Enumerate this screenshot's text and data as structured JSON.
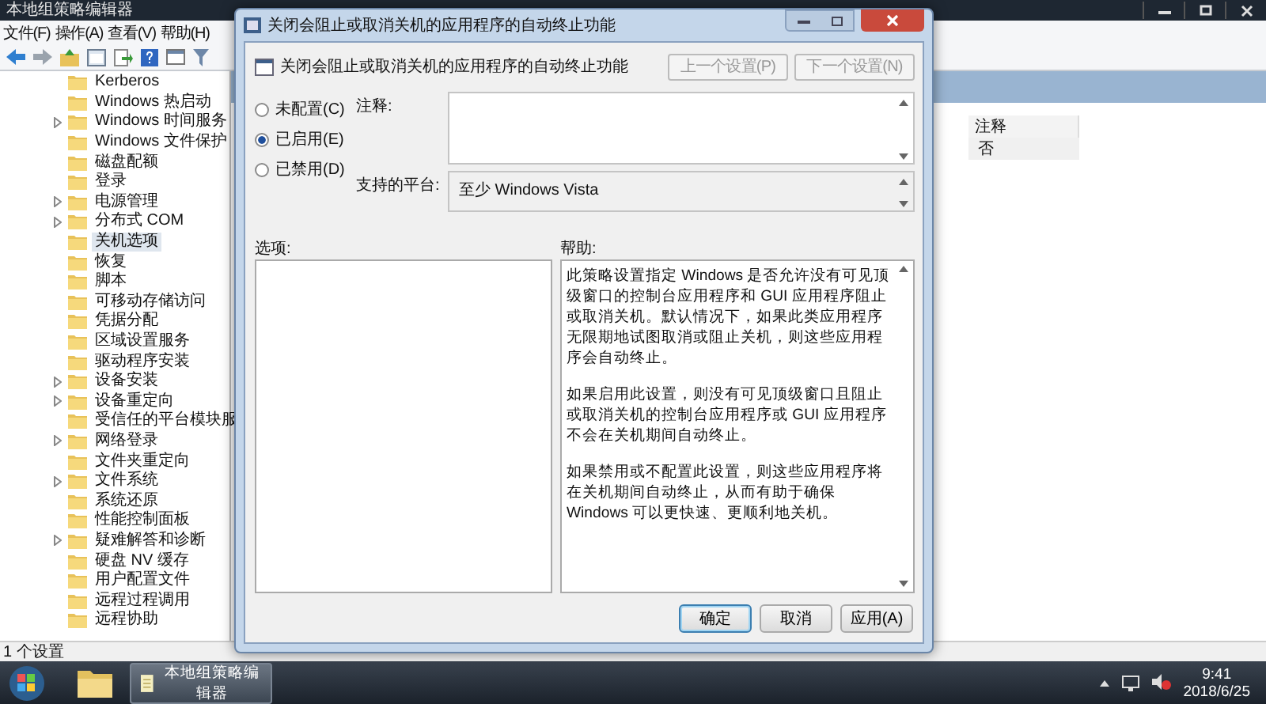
{
  "editor": {
    "title": "本地组策略编辑器",
    "menu": [
      "文件(F)",
      "操作(A)",
      "查看(V)",
      "帮助(H)"
    ],
    "tree": [
      {
        "label": "Kerberos",
        "expandable": false,
        "selected": false
      },
      {
        "label": "Windows 热启动",
        "expandable": false,
        "selected": false
      },
      {
        "label": "Windows 时间服务",
        "expandable": true,
        "selected": false
      },
      {
        "label": "Windows 文件保护",
        "expandable": false,
        "selected": false
      },
      {
        "label": "磁盘配额",
        "expandable": false,
        "selected": false
      },
      {
        "label": "登录",
        "expandable": false,
        "selected": false
      },
      {
        "label": "电源管理",
        "expandable": true,
        "selected": false
      },
      {
        "label": "分布式 COM",
        "expandable": true,
        "selected": false
      },
      {
        "label": "关机选项",
        "expandable": false,
        "selected": true
      },
      {
        "label": "恢复",
        "expandable": false,
        "selected": false
      },
      {
        "label": "脚本",
        "expandable": false,
        "selected": false
      },
      {
        "label": "可移动存储访问",
        "expandable": false,
        "selected": false
      },
      {
        "label": "凭据分配",
        "expandable": false,
        "selected": false
      },
      {
        "label": "区域设置服务",
        "expandable": false,
        "selected": false
      },
      {
        "label": "驱动程序安装",
        "expandable": false,
        "selected": false
      },
      {
        "label": "设备安装",
        "expandable": true,
        "selected": false
      },
      {
        "label": "设备重定向",
        "expandable": true,
        "selected": false
      },
      {
        "label": "受信任的平台模块服",
        "expandable": false,
        "selected": false
      },
      {
        "label": "网络登录",
        "expandable": true,
        "selected": false
      },
      {
        "label": "文件夹重定向",
        "expandable": false,
        "selected": false
      },
      {
        "label": "文件系统",
        "expandable": true,
        "selected": false
      },
      {
        "label": "系统还原",
        "expandable": false,
        "selected": false
      },
      {
        "label": "性能控制面板",
        "expandable": false,
        "selected": false
      },
      {
        "label": "疑难解答和诊断",
        "expandable": true,
        "selected": false
      },
      {
        "label": "硬盘 NV 缓存",
        "expandable": false,
        "selected": false
      },
      {
        "label": "用户配置文件",
        "expandable": false,
        "selected": false
      },
      {
        "label": "远程过程调用",
        "expandable": false,
        "selected": false
      },
      {
        "label": "远程协助",
        "expandable": false,
        "selected": false
      }
    ],
    "columns": [
      "注释"
    ],
    "rows": [
      [
        "否"
      ]
    ],
    "status": "1 个设置"
  },
  "dialog": {
    "title": "关闭会阻止或取消关机的应用程序的自动终止功能",
    "heading": "关闭会阻止或取消关机的应用程序的自动终止功能",
    "nav_buttons": [
      {
        "label": "上一个设置(P)",
        "disabled": true
      },
      {
        "label": "下一个设置(N)",
        "disabled": true
      }
    ],
    "radios": [
      {
        "label": "未配置(C)",
        "selected": false
      },
      {
        "label": "已启用(E)",
        "selected": true
      },
      {
        "label": "已禁用(D)",
        "selected": false
      }
    ],
    "comment_label": "注释:",
    "platform_label": "支持的平台:",
    "platform": "至少 Windows Vista",
    "options_label": "选项:",
    "help_label": "帮助:",
    "help": [
      "此策略设置指定 Windows 是否允许没有可见顶级窗口的控制台应用程序和 GUI 应用程序阻止或取消关机。默认情况下，如果此类应用程序无限期地试图取消或阻止关机，则这些应用程序会自动终止。",
      "如果启用此设置，则没有可见顶级窗口且阻止或取消关机的控制台应用程序或 GUI 应用程序不会在关机期间自动终止。",
      "如果禁用或不配置此设置，则这些应用程序将在关机期间自动终止，从而有助于确保 Windows 可以更快速、更顺利地关机。"
    ],
    "buttons": [
      {
        "label": "确定",
        "default": true
      },
      {
        "label": "取消",
        "default": false
      },
      {
        "label": "应用(A)",
        "default": false
      }
    ]
  },
  "taskbar": {
    "tasks": [
      {
        "label": "本地组策略编辑器",
        "active": true
      }
    ],
    "time": "9:41",
    "date": "2018/6/25"
  }
}
